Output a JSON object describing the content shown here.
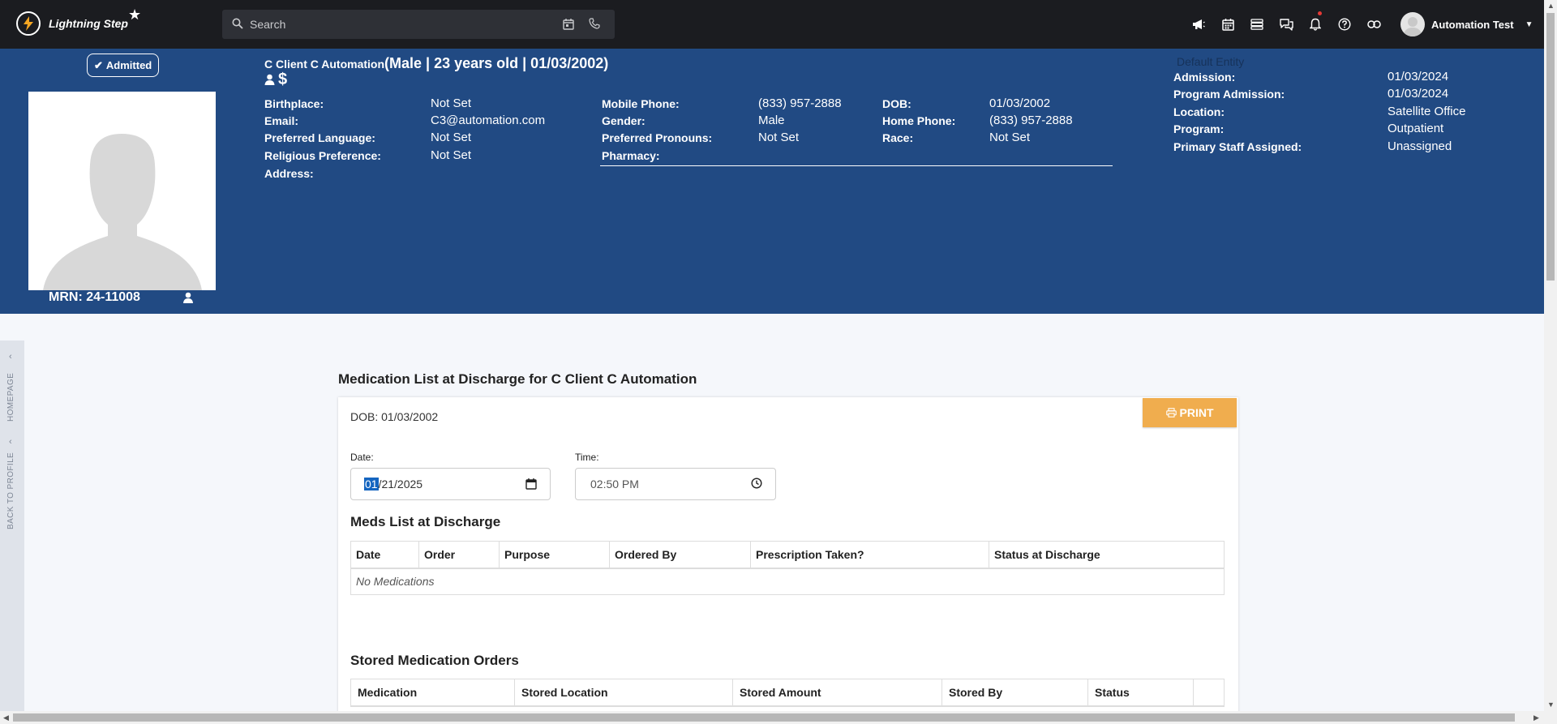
{
  "topbar": {
    "brand": "Lightning Step",
    "search_placeholder": "Search",
    "user_name": "Automation Test"
  },
  "banner": {
    "status_badge": "Admitted",
    "patient_name": "C Client C Automation",
    "patient_meta": "(Male | 23 years old | 01/03/2002)",
    "mrn": "MRN: 24-11008",
    "default_entity": "Default Entity",
    "col1": [
      {
        "label": "Birthplace:",
        "value": "Not Set"
      },
      {
        "label": "Email:",
        "value": "C3@automation.com"
      },
      {
        "label": "Preferred Language:",
        "value": "Not Set"
      },
      {
        "label": "Religious Preference:",
        "value": "Not Set"
      },
      {
        "label": "Address:",
        "value": ""
      }
    ],
    "col2": [
      {
        "label": "Mobile Phone:",
        "value": "(833) 957-2888"
      },
      {
        "label": "Gender:",
        "value": "Male"
      },
      {
        "label": "Preferred Pronouns:",
        "value": "Not Set"
      },
      {
        "label": "Pharmacy:",
        "value": ""
      }
    ],
    "col3": [
      {
        "label": "DOB:",
        "value": "01/03/2002"
      },
      {
        "label": "Home Phone:",
        "value": "(833) 957-2888"
      },
      {
        "label": "Race:",
        "value": "Not Set"
      }
    ],
    "admission": [
      {
        "label": "Admission:",
        "value": "01/03/2024"
      },
      {
        "label": "Program Admission:",
        "value": "01/03/2024"
      },
      {
        "label": "Location:",
        "value": "Satellite Office"
      },
      {
        "label": "Program:",
        "value": "Outpatient"
      },
      {
        "label": "Primary Staff Assigned:",
        "value": "Unassigned"
      }
    ]
  },
  "rail": {
    "homepage": "HOMEPAGE",
    "back_to_profile": "BACK TO PROFILE"
  },
  "main": {
    "title": "Medication List at Discharge for C Client C Automation",
    "dob_line": "DOB: 01/03/2002",
    "print_label": "PRINT",
    "date_label": "Date:",
    "date_month": "01",
    "date_rest": "/21/2025",
    "time_label": "Time:",
    "time_value": "02:50 PM",
    "meds_title": "Meds List at Discharge",
    "meds_columns": [
      "Date",
      "Order",
      "Purpose",
      "Ordered By",
      "Prescription Taken?",
      "Status at Discharge"
    ],
    "meds_empty": "No Medications",
    "stored_title": "Stored Medication Orders",
    "stored_columns": [
      "Medication",
      "Stored Location",
      "Stored Amount",
      "Stored By",
      "Status",
      ""
    ]
  }
}
